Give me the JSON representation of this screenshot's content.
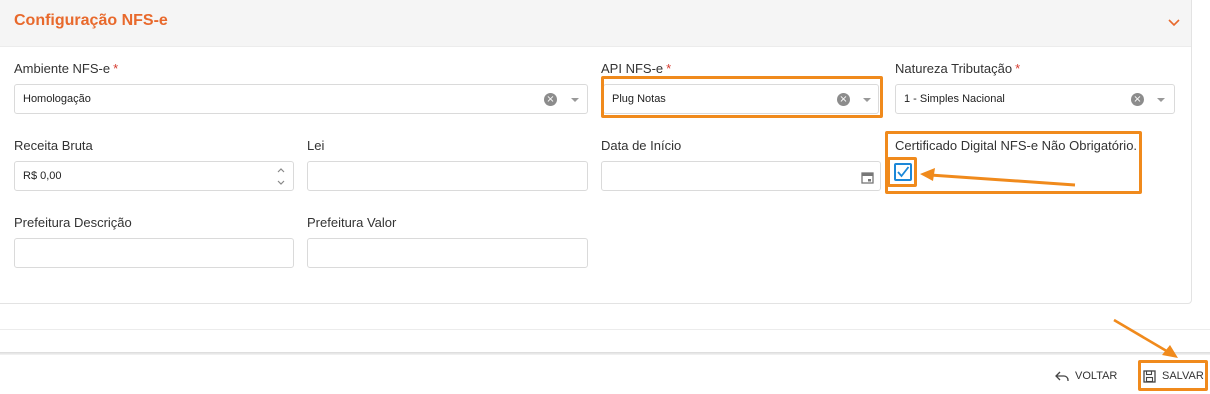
{
  "panel": {
    "title": "Configuração NFS-e"
  },
  "fields": {
    "ambiente": {
      "label": "Ambiente NFS-e",
      "required": "*",
      "value": "Homologação"
    },
    "api": {
      "label": "API NFS-e",
      "required": "*",
      "value": "Plug Notas"
    },
    "natureza": {
      "label": "Natureza Tributação",
      "required": "*",
      "value": "1 - Simples Nacional"
    },
    "receita": {
      "label": "Receita Bruta",
      "value": "R$ 0,00"
    },
    "lei": {
      "label": "Lei",
      "value": ""
    },
    "data_inicio": {
      "label": "Data de Início",
      "value": ""
    },
    "certificado": {
      "label": "Certificado Digital NFS-e Não Obrigatório.",
      "checked": true
    },
    "prefeitura_descricao": {
      "label": "Prefeitura Descrição",
      "value": ""
    },
    "prefeitura_valor": {
      "label": "Prefeitura Valor",
      "value": ""
    }
  },
  "footer": {
    "voltar_label": "VOLTAR",
    "salvar_label": "SALVAR"
  },
  "colors": {
    "accent": "#e8692c",
    "highlight": "#f08a1c",
    "checkbox": "#1b87d8"
  },
  "icons": [
    "chevron-down-icon",
    "clear-icon",
    "dropdown-caret-icon",
    "spinner-up-icon",
    "spinner-down-icon",
    "calendar-icon",
    "checkmark-icon",
    "back-arrow-icon",
    "save-icon",
    "annotation-arrow"
  ]
}
